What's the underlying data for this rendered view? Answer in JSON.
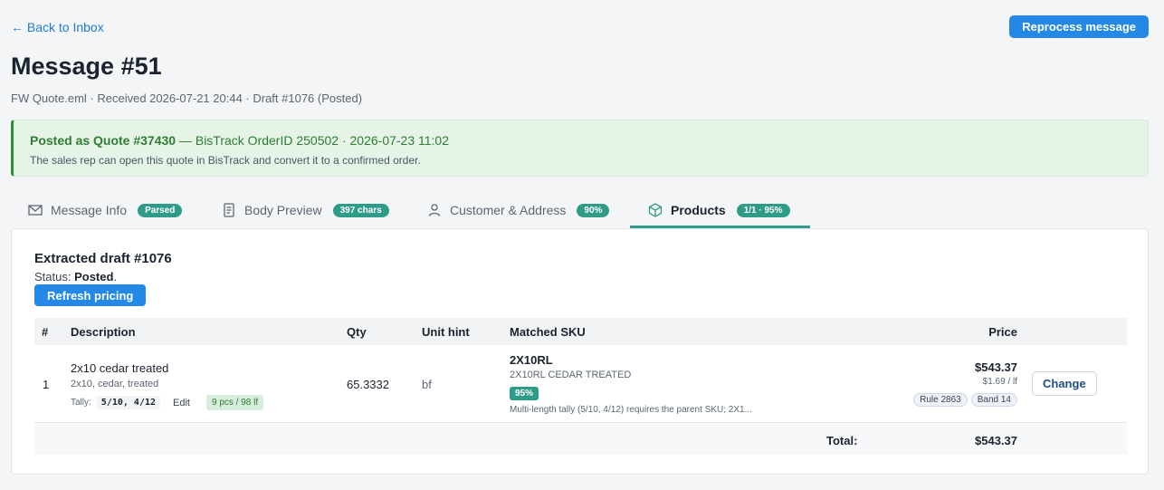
{
  "nav": {
    "back_label": "← Back to Inbox",
    "reprocess_label": "Reprocess message"
  },
  "header": {
    "title": "Message #51",
    "subtitle": "FW Quote.eml · Received 2026-07-21 20:44 · Draft #1076 (Posted)"
  },
  "banner": {
    "strong": "Posted as Quote #37430",
    "rest": " — BisTrack OrderID 250502 · 2026-07-23 11:02",
    "note": "The sales rep can open this quote in BisTrack and convert it to a confirmed order."
  },
  "tabs": [
    {
      "label": "Message Info",
      "badge": "Parsed",
      "icon": "envelope-icon"
    },
    {
      "label": "Body Preview",
      "badge": "397 chars",
      "icon": "document-icon"
    },
    {
      "label": "Customer & Address",
      "badge": "90%",
      "icon": "person-icon"
    },
    {
      "label": "Products",
      "badge": "1/1 · 95%",
      "icon": "box-icon",
      "active": true
    }
  ],
  "draft": {
    "title": "Extracted draft #1076",
    "status_label": "Status: ",
    "status_value": "Posted",
    "status_end": ".",
    "refresh_label": "Refresh pricing"
  },
  "table": {
    "headers": {
      "num": "#",
      "description": "Description",
      "qty": "Qty",
      "unit": "Unit hint",
      "sku": "Matched SKU",
      "price": "Price"
    },
    "rows": [
      {
        "num": "1",
        "description": "2x10 cedar treated",
        "description_sub": "2x10, cedar, treated",
        "tally_label": "Tally:",
        "tally_code": "5/10, 4/12",
        "tally_edit": "Edit",
        "tally_pill": "9 pcs / 98 lf",
        "qty": "65.3332",
        "unit": "bf",
        "sku_code": "2X10RL",
        "sku_name": "2X10RL CEDAR TREATED",
        "sku_pct": "95%",
        "sku_note": "Multi-length tally (5/10, 4/12) requires the parent SKU; 2X1...",
        "price": "$543.37",
        "unit_price": "$1.69 / lf",
        "rule": "Rule 2863",
        "band": "Band 14",
        "change_label": "Change"
      }
    ],
    "total_label": "Total:",
    "total_value": "$543.37"
  },
  "colors": {
    "accent": "#2388e6",
    "teal": "#2f9c8a",
    "success": "#2e7d32"
  }
}
